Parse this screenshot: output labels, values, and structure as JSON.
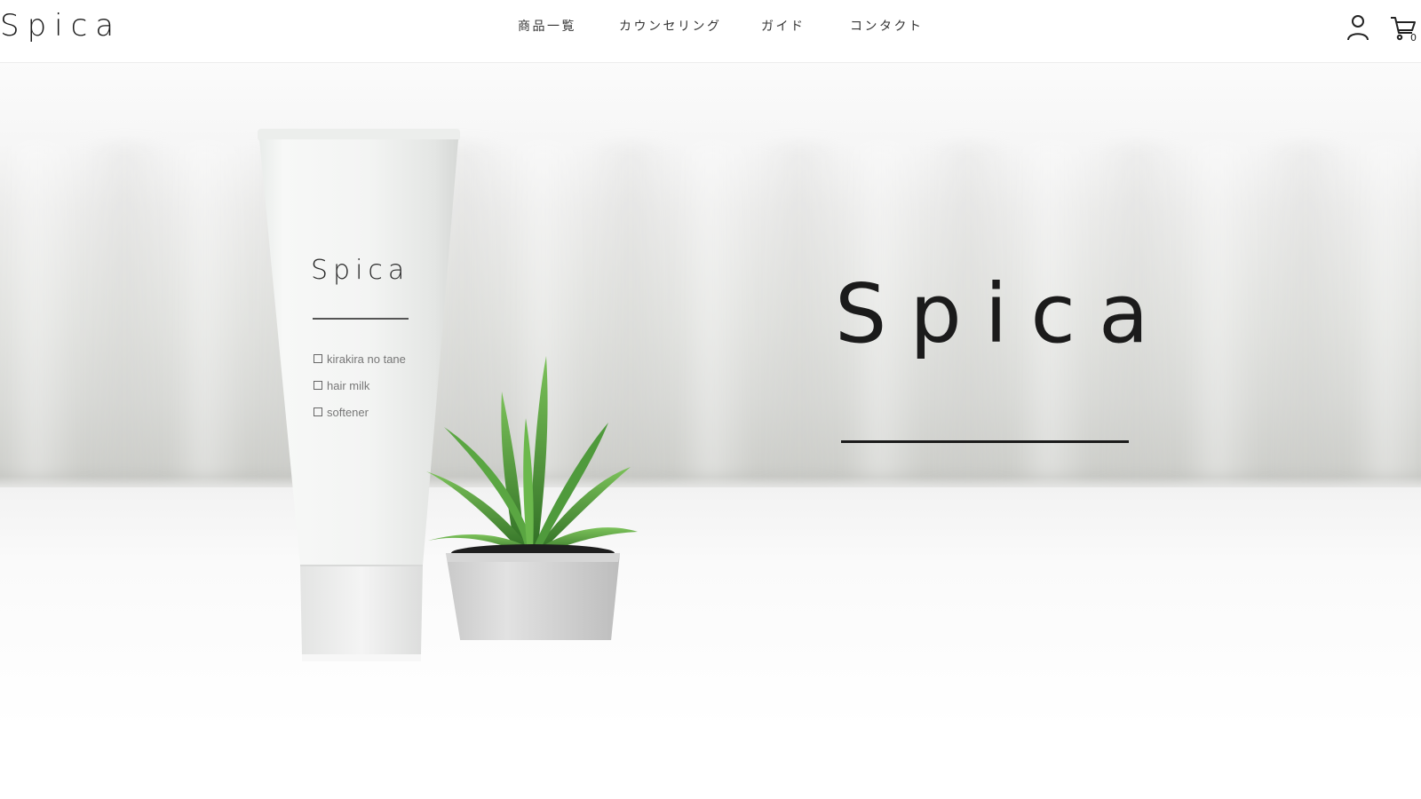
{
  "header": {
    "logo": "Spica",
    "nav": [
      {
        "label": "商品一覧"
      },
      {
        "label": "カウンセリング"
      },
      {
        "label": "ガイド"
      },
      {
        "label": "コンタクト"
      }
    ],
    "account_icon": "person-icon",
    "cart_icon": "cart-icon",
    "cart_count": "0"
  },
  "hero": {
    "title": "Spica",
    "product": {
      "brand": "Spica",
      "items": [
        {
          "label": "kirakira no tane"
        },
        {
          "label": "hair milk"
        },
        {
          "label": "softener"
        }
      ]
    }
  },
  "colors": {
    "text": "#1b1b1b",
    "nav_text": "#333333",
    "background": "#ffffff",
    "plant_green": "#4f9a3c"
  }
}
